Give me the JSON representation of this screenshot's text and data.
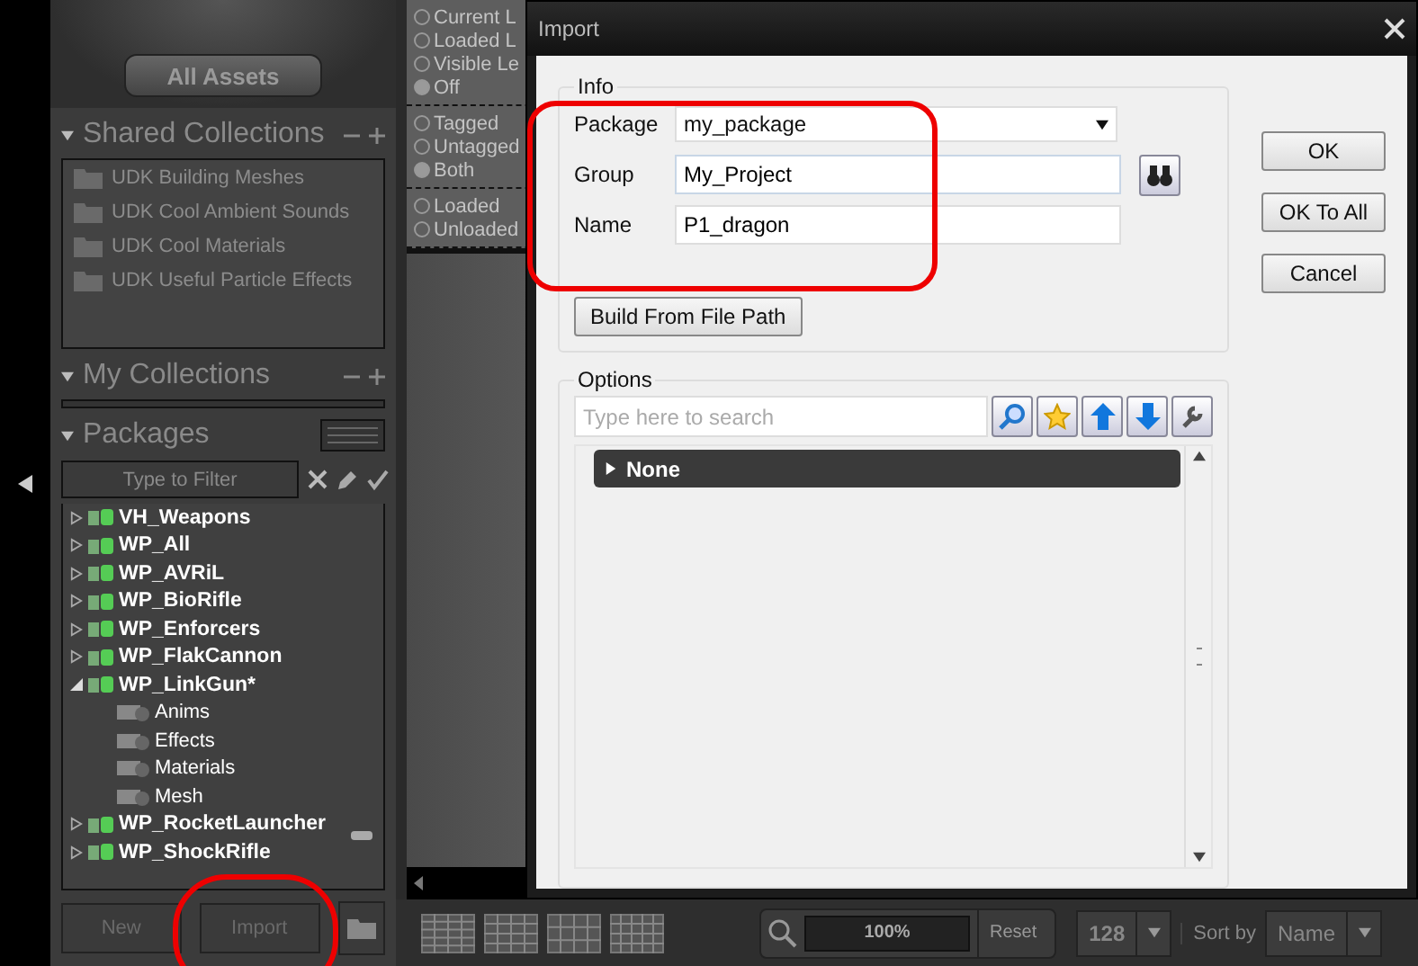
{
  "sidebar": {
    "all_assets_button": "All Assets",
    "shared_collections": {
      "title": "Shared Collections",
      "expanded": true,
      "items": [
        {
          "label": "UDK Building Meshes"
        },
        {
          "label": "UDK Cool Ambient Sounds"
        },
        {
          "label": "UDK Cool Materials"
        },
        {
          "label": "UDK Useful Particle Effects"
        }
      ]
    },
    "my_collections": {
      "title": "My Collections",
      "expanded": true
    },
    "packages": {
      "title": "Packages",
      "expanded": true,
      "filter_placeholder": "Type to Filter",
      "tree": [
        {
          "label": "VH_Weapons",
          "expanded": false
        },
        {
          "label": "WP_All",
          "expanded": false
        },
        {
          "label": "WP_AVRiL",
          "expanded": false
        },
        {
          "label": "WP_BioRifle",
          "expanded": false
        },
        {
          "label": "WP_Enforcers",
          "expanded": false
        },
        {
          "label": "WP_FlakCannon",
          "expanded": false
        },
        {
          "label": "WP_LinkGun*",
          "expanded": true,
          "children": [
            {
              "label": "Anims"
            },
            {
              "label": "Effects"
            },
            {
              "label": "Materials"
            },
            {
              "label": "Mesh"
            }
          ]
        },
        {
          "label": "WP_RocketLauncher",
          "expanded": false
        },
        {
          "label": "WP_ShockRifle",
          "expanded": false
        }
      ]
    },
    "buttons": [
      {
        "label": "New",
        "disabled": true
      },
      {
        "label": "Import",
        "disabled": true
      }
    ]
  },
  "filters": [
    [
      {
        "label": "Current L",
        "selected": false
      },
      {
        "label": "Loaded L",
        "selected": false
      },
      {
        "label": "Visible Le",
        "selected": false
      },
      {
        "label": "Off",
        "selected": true
      }
    ],
    [
      {
        "label": "Tagged",
        "selected": false
      },
      {
        "label": "Untagged",
        "selected": false
      },
      {
        "label": "Both",
        "selected": true
      }
    ],
    [
      {
        "label": "Loaded",
        "selected": false
      },
      {
        "label": "Unloaded",
        "selected": false
      }
    ]
  ],
  "dialog": {
    "title": "Import",
    "info": {
      "title": "Info",
      "fields": [
        {
          "kind": "combo",
          "label": "Package",
          "value": "my_package"
        },
        {
          "kind": "browse",
          "label": "Group",
          "value": "My_Project"
        },
        {
          "kind": "text",
          "label": "Name",
          "value": "P1_dragon"
        }
      ],
      "build_button": "Build From File Path"
    },
    "options": {
      "title": "Options",
      "search_placeholder": "Type here to search",
      "categories": [
        {
          "label": "None",
          "expanded": false
        }
      ]
    },
    "buttons": [
      "OK",
      "OK To All",
      "Cancel"
    ]
  },
  "bottom_bar": {
    "zoom": "100%",
    "reset": "Reset",
    "size": "128",
    "sort_label": "Sort by",
    "sort_value": "Name"
  }
}
